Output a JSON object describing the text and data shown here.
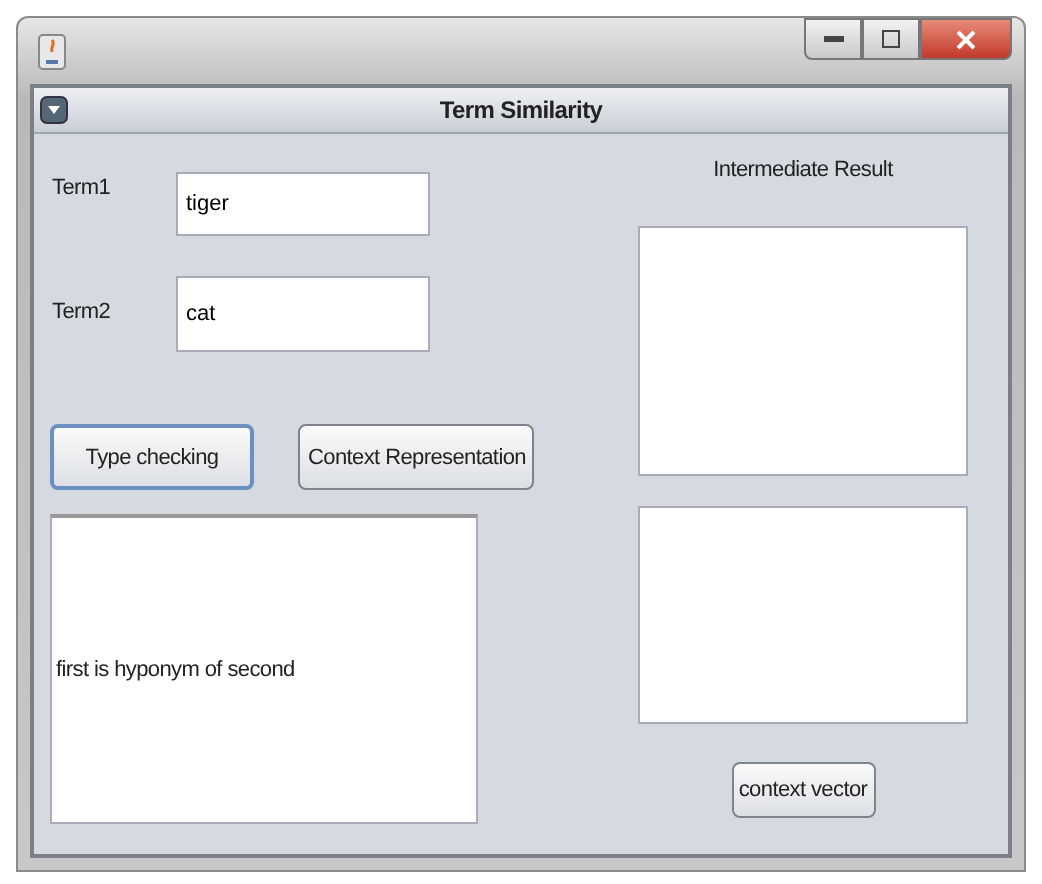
{
  "window": {
    "title": "Term Similarity"
  },
  "fields": [
    {
      "label": "Term1",
      "value": "tiger"
    },
    {
      "label": "Term2",
      "value": "cat"
    }
  ],
  "buttons": [
    {
      "label": "Type checking",
      "focused": true
    },
    {
      "label": "Context Representation",
      "focused": false
    }
  ],
  "result": {
    "text": "first is hyponym of second"
  },
  "intermediate": {
    "title": "Intermediate Result",
    "button": "context vector"
  }
}
